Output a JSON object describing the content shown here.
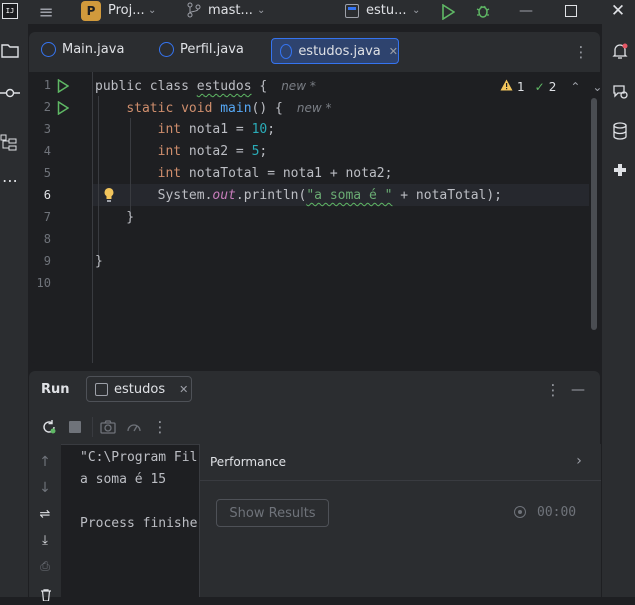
{
  "titlebar": {
    "app_badge": "IJ",
    "project_badge": "P",
    "project_name": "Proj...",
    "branch_name": "mast...",
    "run_config": "estu..."
  },
  "tabs": [
    {
      "label": "Main.java",
      "active": false
    },
    {
      "label": "Perfil.java",
      "active": false
    },
    {
      "label": "estudos.java",
      "active": true
    }
  ],
  "inspection": {
    "warnings": "1",
    "checks": "2"
  },
  "code": {
    "line_numbers": [
      "1",
      "2",
      "3",
      "4",
      "5",
      "6",
      "7",
      "8",
      "9",
      "10"
    ],
    "lines": [
      {
        "tokens": [
          {
            "t": "public class ",
            "c": "kw0"
          },
          {
            "t": "estudos",
            "c": "id"
          },
          {
            "t": " {",
            "c": "p"
          }
        ],
        "hint": "new *"
      },
      {
        "tokens": [
          {
            "t": "    ",
            "c": "p"
          },
          {
            "t": "static void ",
            "c": "kw"
          },
          {
            "t": "main",
            "c": "fn"
          },
          {
            "t": "() {",
            "c": "p"
          }
        ],
        "hint": "new *"
      },
      {
        "tokens": [
          {
            "t": "        ",
            "c": "p"
          },
          {
            "t": "int",
            "c": "kw"
          },
          {
            "t": " nota1 = ",
            "c": "p"
          },
          {
            "t": "10",
            "c": "num"
          },
          {
            "t": ";",
            "c": "p"
          }
        ]
      },
      {
        "tokens": [
          {
            "t": "        ",
            "c": "p"
          },
          {
            "t": "int",
            "c": "kw"
          },
          {
            "t": " nota2 = ",
            "c": "p"
          },
          {
            "t": "5",
            "c": "num"
          },
          {
            "t": ";",
            "c": "p"
          }
        ]
      },
      {
        "tokens": [
          {
            "t": "        ",
            "c": "p"
          },
          {
            "t": "int",
            "c": "kw"
          },
          {
            "t": " notaTotal = nota1 + nota2;",
            "c": "p"
          }
        ]
      },
      {
        "tokens": [
          {
            "t": "        System.",
            "c": "p"
          },
          {
            "t": "out",
            "c": "fld"
          },
          {
            "t": ".println(",
            "c": "p"
          },
          {
            "t": "\"a soma é \"",
            "c": "str"
          },
          {
            "t": " + notaTotal);",
            "c": "p"
          }
        ]
      },
      {
        "tokens": [
          {
            "t": "    }",
            "c": "p"
          }
        ]
      },
      {
        "tokens": []
      },
      {
        "tokens": [
          {
            "t": "}",
            "c": "p"
          }
        ]
      },
      {
        "tokens": []
      }
    ]
  },
  "run": {
    "title": "Run",
    "tab_label": "estudos",
    "console_lines": [
      "\"C:\\Program Fil",
      "a soma é 15",
      "",
      "Process finishe"
    ]
  },
  "performance": {
    "title": "Performance",
    "show_results": "Show Results",
    "timer": "00:00"
  },
  "colors": {
    "accent": "#3574f0",
    "run_green": "#5fb865",
    "warning_yellow": "#f2c55c",
    "bulb_yellow": "#f2c55c"
  }
}
